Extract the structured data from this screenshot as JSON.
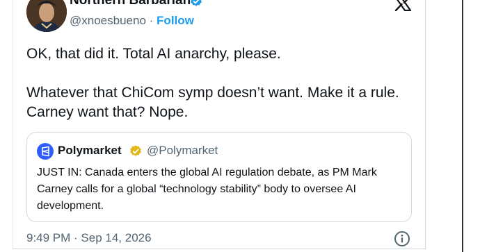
{
  "author": {
    "name": "Northern Barbarian",
    "handle": "@xnoesbueno",
    "separator": "·",
    "follow_label": "Follow",
    "verified": true,
    "verified_color": "#1d9bf0"
  },
  "tweet": {
    "paragraphs": [
      "OK, that did it. Total AI anarchy, please.",
      "Whatever that ChiCom symp doesn’t want. Make it a rule. Carney want that? Nope."
    ],
    "timestamp": "9:49 PM · Sep 14, 2026"
  },
  "quoted_tweet": {
    "name": "Polymarket",
    "handle": "@Polymarket",
    "verified_color": "#e2b719",
    "text": "JUST IN: Canada enters the global AI regulation debate, as PM Mark Carney calls for a global “technology stability” body to oversee AI development.",
    "logo_color": "#2e5cff"
  },
  "icons": {
    "brand": "x-logo-icon",
    "info": "info-icon",
    "verified": "verified-badge-icon"
  },
  "colors": {
    "text_primary": "#0f1419",
    "text_secondary": "#536471",
    "link": "#1d9bf0",
    "border": "#cfd9de"
  }
}
